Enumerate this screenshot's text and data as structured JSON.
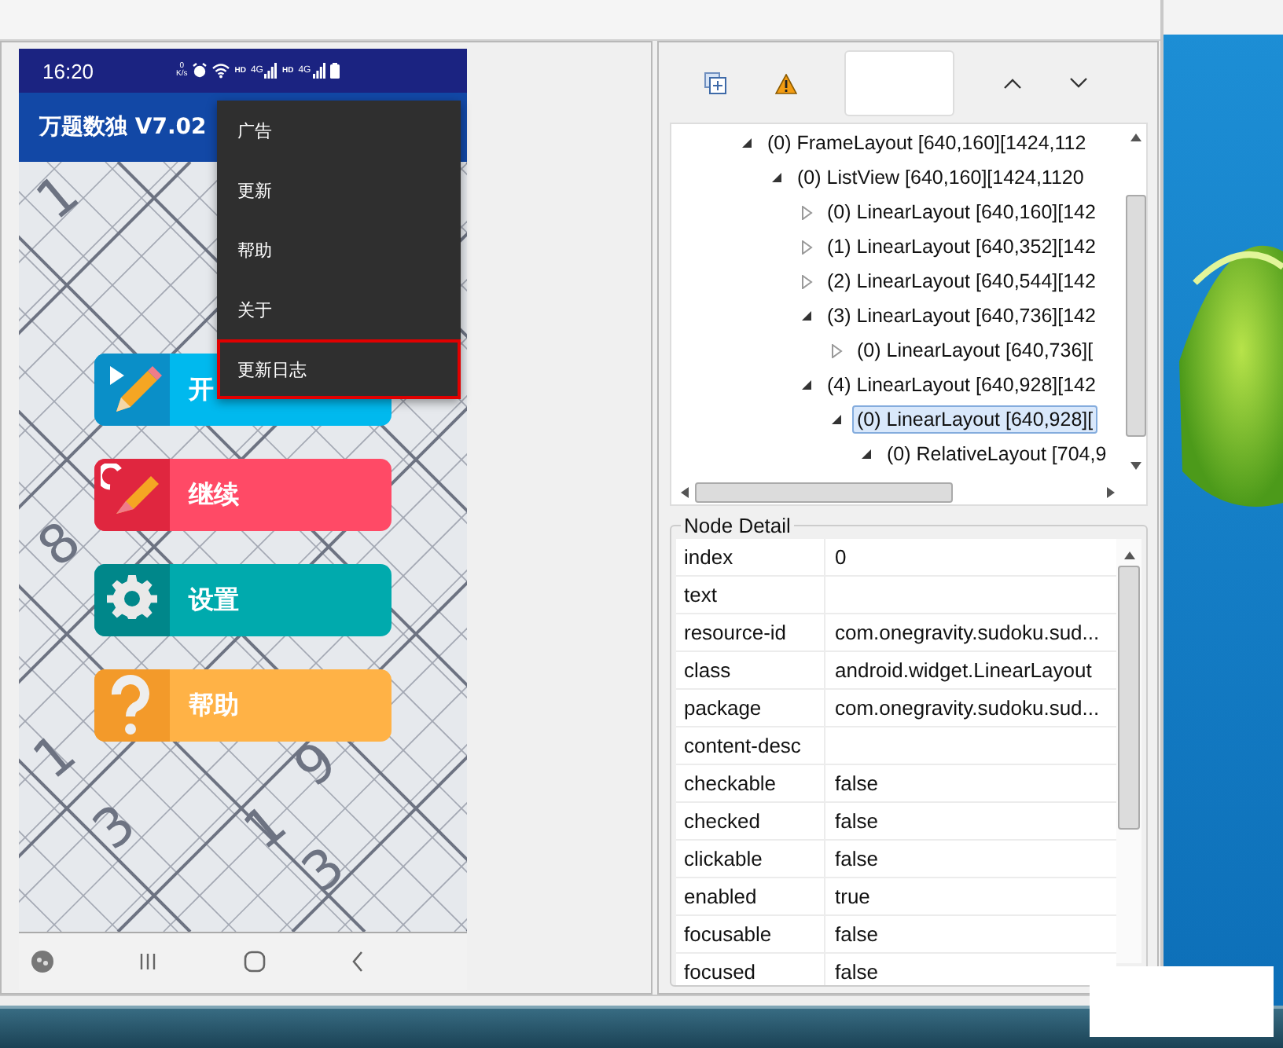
{
  "phone": {
    "status_bar": {
      "time": "16:20",
      "net_speed": [
        "0",
        "K/s"
      ],
      "networks": [
        {
          "hd": "HD",
          "gen": "4G"
        },
        {
          "hd": "HD",
          "gen": "4G"
        }
      ]
    },
    "app_title": "万题数独 V7.02",
    "background_digits": [
      "1",
      "8",
      "9",
      "1",
      "3",
      "1",
      "3"
    ],
    "buttons": [
      {
        "kind": "start",
        "label": "开"
      },
      {
        "kind": "continue",
        "label": "继续"
      },
      {
        "kind": "settings",
        "label": "设置"
      },
      {
        "kind": "help",
        "label": "帮助"
      }
    ],
    "menu": [
      {
        "label": "广告",
        "highlighted": false
      },
      {
        "label": "更新",
        "highlighted": false
      },
      {
        "label": "帮助",
        "highlighted": false
      },
      {
        "label": "关于",
        "highlighted": false
      },
      {
        "label": "更新日志",
        "highlighted": true
      }
    ]
  },
  "tree": [
    {
      "label": "(0) FrameLayout [640,160][1424,112",
      "expanded": true,
      "selected": false,
      "children": [
        {
          "label": "(0) ListView [640,160][1424,1120",
          "expanded": true,
          "selected": false,
          "children": [
            {
              "label": "(0) LinearLayout [640,160][142",
              "expanded": false,
              "selected": false
            },
            {
              "label": "(1) LinearLayout [640,352][142",
              "expanded": false,
              "selected": false
            },
            {
              "label": "(2) LinearLayout [640,544][142",
              "expanded": false,
              "selected": false
            },
            {
              "label": "(3) LinearLayout [640,736][142",
              "expanded": true,
              "selected": false,
              "children": [
                {
                  "label": "(0) LinearLayout [640,736][",
                  "expanded": false,
                  "selected": false
                }
              ]
            },
            {
              "label": "(4) LinearLayout [640,928][142",
              "expanded": true,
              "selected": false,
              "children": [
                {
                  "label": "(0) LinearLayout [640,928][",
                  "expanded": true,
                  "selected": true,
                  "children": [
                    {
                      "label": "(0) RelativeLayout [704,9",
                      "expanded": true,
                      "selected": false
                    }
                  ]
                }
              ]
            }
          ]
        }
      ]
    }
  ],
  "node_detail": {
    "title": "Node Detail",
    "rows": [
      {
        "key": "index",
        "value": "0"
      },
      {
        "key": "text"
      },
      {
        "key": "resource-id",
        "value": "com.onegravity.sudoku.sud..."
      },
      {
        "key": "class",
        "value": "android.widget.LinearLayout"
      },
      {
        "key": "package",
        "value": "com.onegravity.sudoku.sud..."
      },
      {
        "key": "content-desc"
      },
      {
        "key": "checkable",
        "value": "false"
      },
      {
        "key": "checked",
        "value": "false"
      },
      {
        "key": "clickable",
        "value": "false"
      },
      {
        "key": "enabled",
        "value": "true"
      },
      {
        "key": "focusable",
        "value": "false"
      },
      {
        "key": "focused",
        "value": "false"
      }
    ]
  }
}
